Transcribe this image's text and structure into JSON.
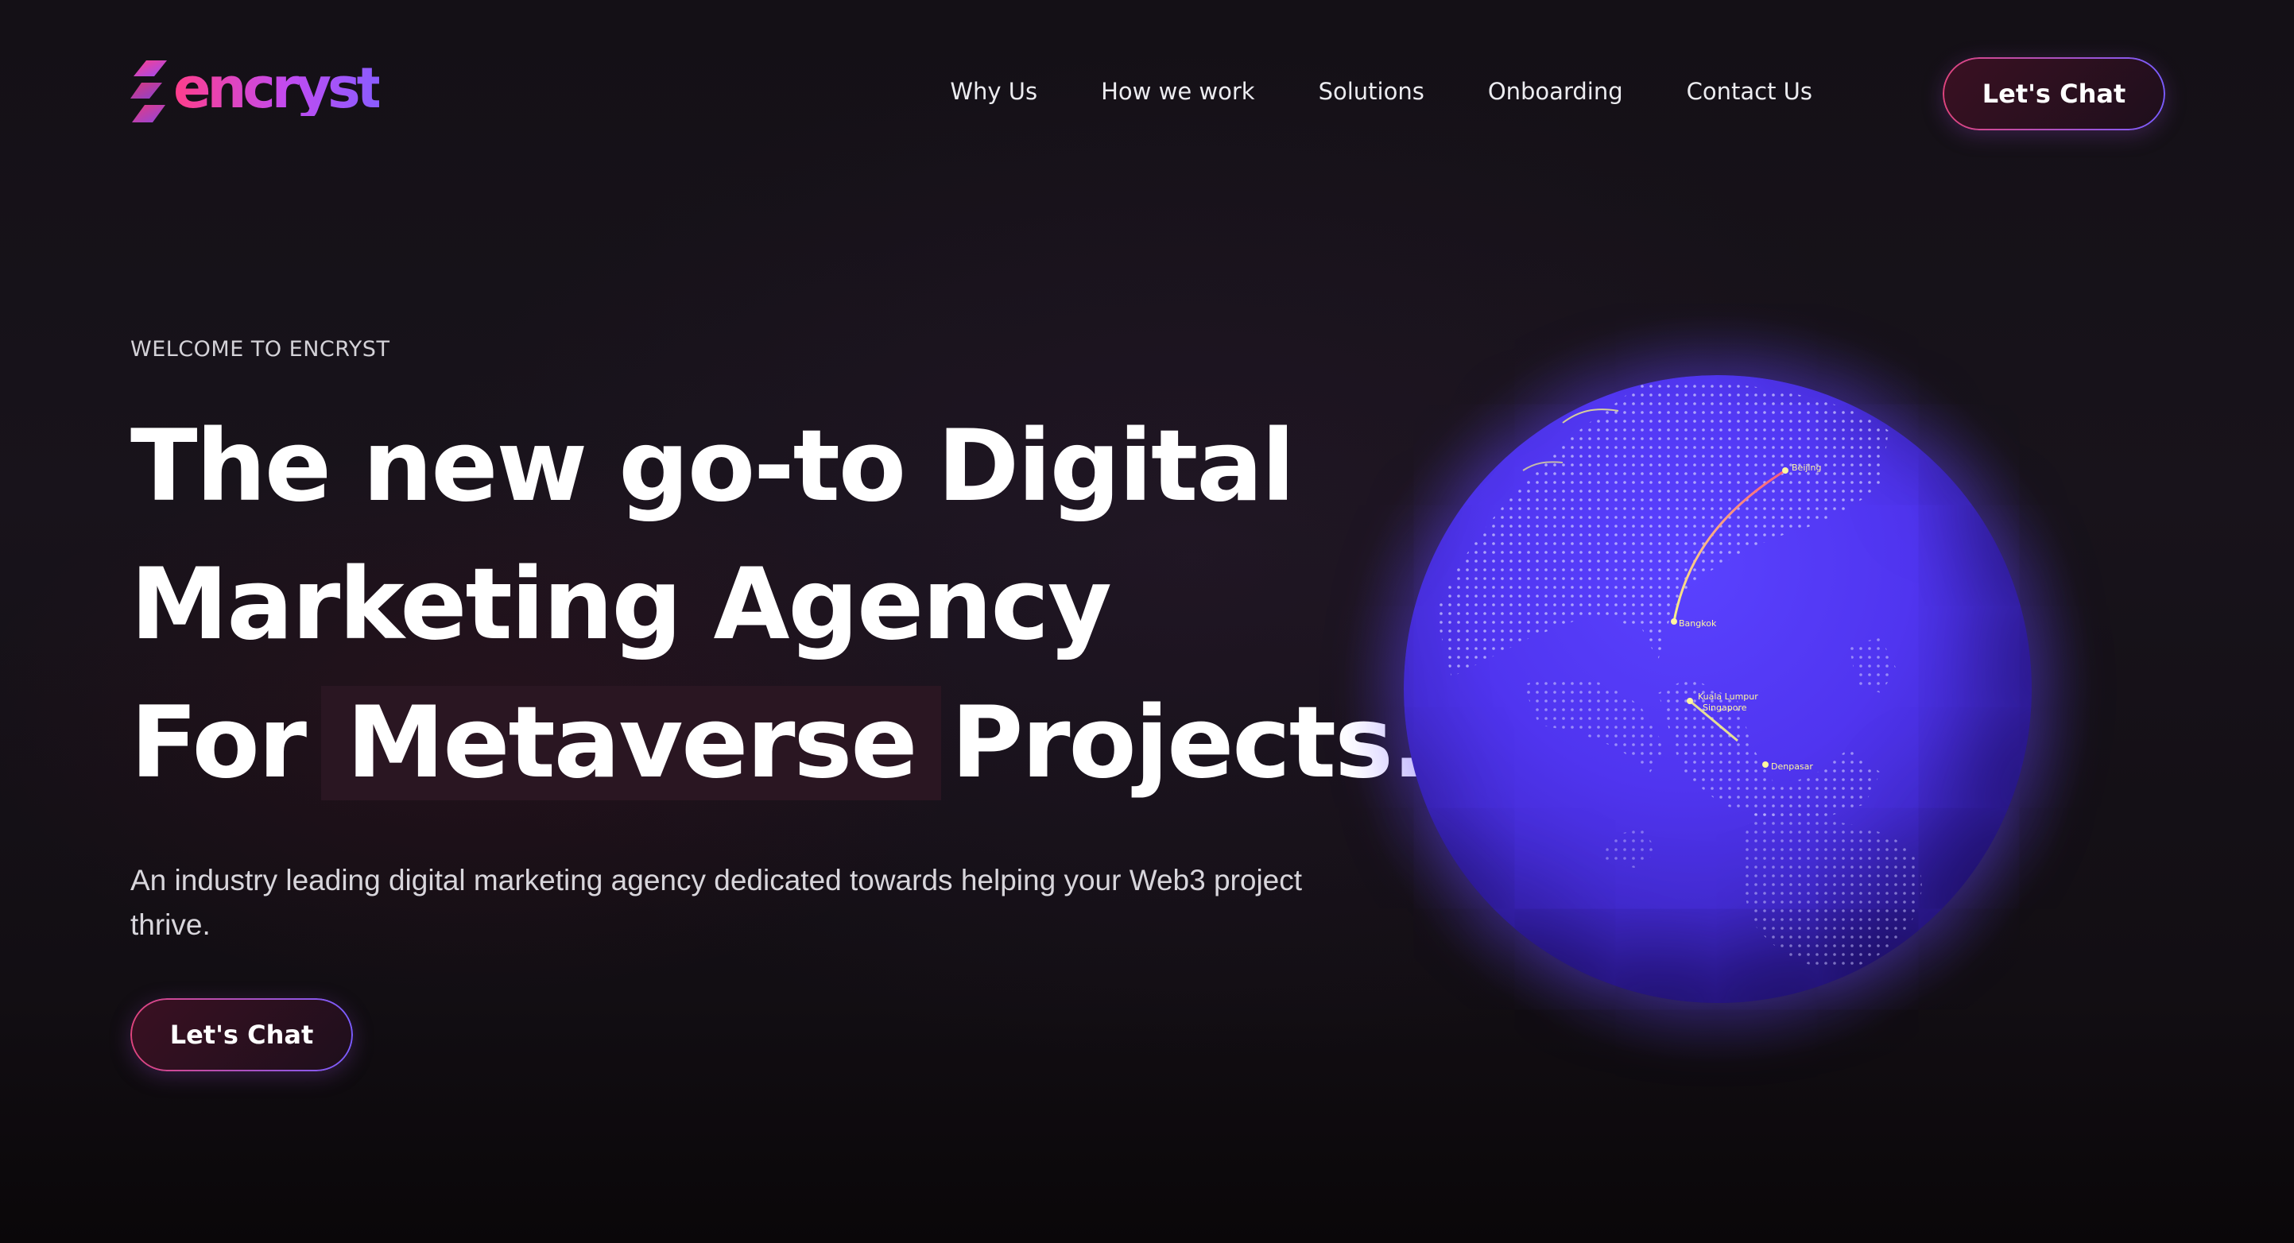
{
  "brand": {
    "logo_text": "encryst",
    "colors": {
      "pink": "#ff3e8a",
      "purple": "#8a5cff"
    }
  },
  "nav": {
    "items": [
      {
        "label": "Why Us"
      },
      {
        "label": "How we work"
      },
      {
        "label": "Solutions"
      },
      {
        "label": "Onboarding"
      },
      {
        "label": "Contact Us"
      }
    ],
    "cta_label": "Let's Chat"
  },
  "hero": {
    "eyebrow": "WELCOME TO ENCRYST",
    "headline_line1": "The new go-to Digital",
    "headline_line2": "Marketing Agency",
    "headline_line3_prefix": "For",
    "headline_highlight": "Metaverse",
    "headline_line3_suffix": "Projects.",
    "subtext": "An industry leading digital marketing agency dedicated towards helping your Web3 project thrive.",
    "cta_label": "Let's Chat"
  },
  "globe": {
    "color": "#5035f0",
    "labels": [
      "Beijing",
      "Bangkok",
      "Kuala Lumpur",
      "Singapore",
      "Denpasar"
    ]
  }
}
